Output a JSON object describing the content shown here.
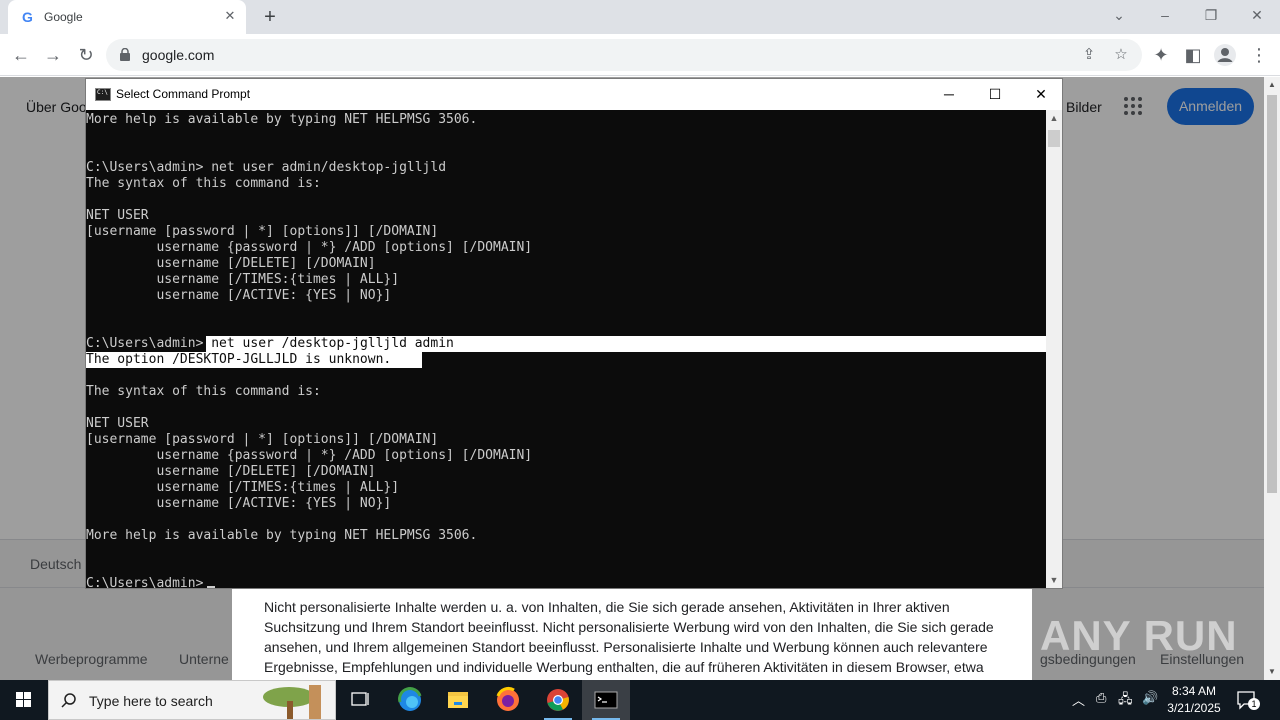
{
  "browser": {
    "tab_title": "Google",
    "tab_favicon": "G",
    "tab_close": "✕",
    "new_tab": "+",
    "url": "google.com"
  },
  "google_page": {
    "about_link": "Über Goo",
    "images_link": "Bilder",
    "signin_label": "Anmelden",
    "country": "Deutsch",
    "footer_links": [
      "Werbeprogramme",
      "Unterne",
      "gsbedingungen",
      "Einstellungen"
    ],
    "consent_text": "Nicht personalisierte Inhalte werden u. a. von Inhalten, die Sie sich gerade ansehen, Aktivitäten in Ihrer aktiven Suchsitzung und Ihrem Standort beeinflusst. Nicht personalisierte Werbung wird von den Inhalten, die Sie sich gerade ansehen, und Ihrem allgemeinen Standort beeinflusst. Personalisierte Inhalte und Werbung können auch relevantere Ergebnisse, Empfehlungen und individuelle Werbung enthalten, die auf früheren Aktivitäten in diesem Browser, etwa Suchanfragen bei Google, beruhen. Sofern relevant, verwenden wir Cookies und Daten"
  },
  "cmd": {
    "title": "Select Command Prompt",
    "lines": [
      "More help is available by typing NET HELPMSG 3506.",
      "",
      "",
      "C:\\Users\\admin> net user admin/desktop-jglljld",
      "The syntax of this command is:",
      "",
      "NET USER",
      "[username [password | *] [options]] [/DOMAIN]",
      "         username {password | *} /ADD [options] [/DOMAIN]",
      "         username [/DELETE] [/DOMAIN]",
      "         username [/TIMES:{times | ALL}]",
      "         username [/ACTIVE: {YES | NO}]",
      "",
      "",
      "C:\\Users\\admin> net user /desktop-jglljld admin",
      "The option /DESKTOP-JGLLJLD is unknown.",
      "",
      "The syntax of this command is:",
      "",
      "NET USER",
      "[username [password | *] [options]] [/DOMAIN]",
      "         username {password | *} /ADD [options] [/DOMAIN]",
      "         username [/DELETE] [/DOMAIN]",
      "         username [/TIMES:{times | ALL}]",
      "         username [/ACTIVE: {YES | NO}]",
      "",
      "More help is available by typing NET HELPMSG 3506.",
      "",
      "",
      "C:\\Users\\admin>"
    ],
    "selected_lines": [
      14,
      15
    ]
  },
  "watermark": "ANY RUN",
  "taskbar": {
    "search_placeholder": "Type here to search",
    "time": "8:34 AM",
    "date": "3/21/2025",
    "notification_count": "1"
  },
  "colors": {
    "chrome_blue": "#1a73e8",
    "console_bg": "#0c0c0c",
    "console_fg": "#cccccc",
    "taskbar_bg": "#101820"
  }
}
